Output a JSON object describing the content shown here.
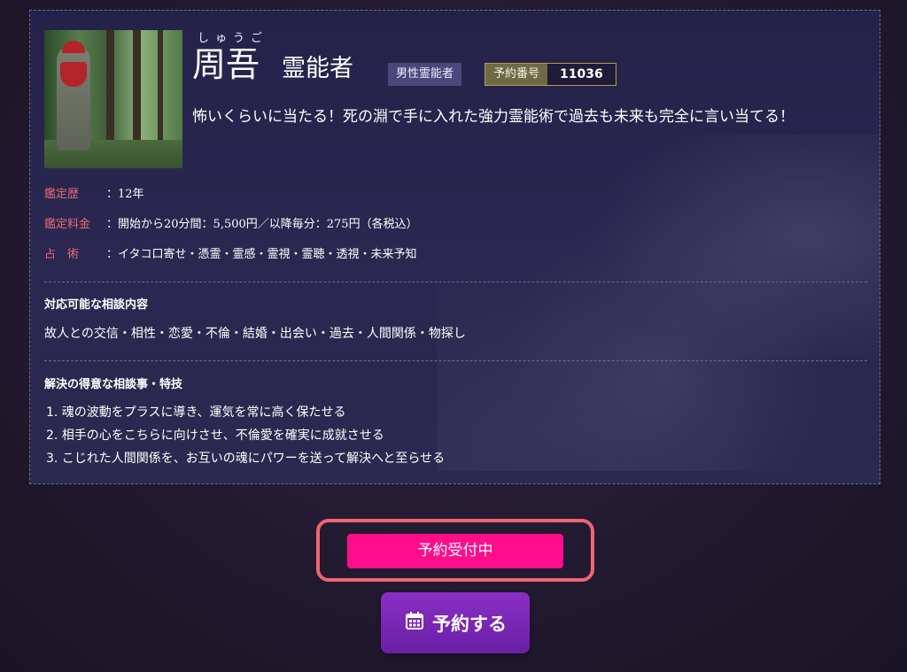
{
  "profile": {
    "name_ruby": "しゅうご",
    "name": "周吾",
    "title": "霊能者",
    "gender_tag": "男性霊能者",
    "reservation_label": "予約番号",
    "reservation_number": "11036",
    "catchphrase": "怖いくらいに当たる！死の淵で手に入れた強力霊能術で過去も未来も完全に言い当てる！",
    "photo_icon": "jizo-statue-photo"
  },
  "info": [
    {
      "key": "鑑定歴",
      "value": "：12年"
    },
    {
      "key": "鑑定料金",
      "value": "：開始から20分間：5,500円／以降毎分：275円（各税込）"
    },
    {
      "key": "占　術",
      "value": "：イタコ口寄せ・憑霊・霊感・霊視・霊聴・透視・未来予知"
    }
  ],
  "consult": {
    "title": "対応可能な相談内容",
    "text": "故人との交信・相性・恋愛・不倫・結婚・出会い・過去・人間関係・物探し"
  },
  "specialty": {
    "title": "解決の得意な相談事・特技",
    "items": [
      "1. 魂の波動をプラスに導き、運気を常に高く保たせる",
      "2. 相手の心をこちらに向けさせ、不倫愛を確実に成就させる",
      "3. こじれた人間関係を、お互いの魂にパワーを送って解決へと至らせる"
    ]
  },
  "status_button": "予約受付中",
  "reserve_button": {
    "label": "予約する",
    "icon": "calendar-icon"
  },
  "colors": {
    "status_pink": "#ff0d8a",
    "highlight_frame": "#ef6670",
    "reserve_purple": "#7a27b6",
    "info_key": "#e86a7a"
  }
}
